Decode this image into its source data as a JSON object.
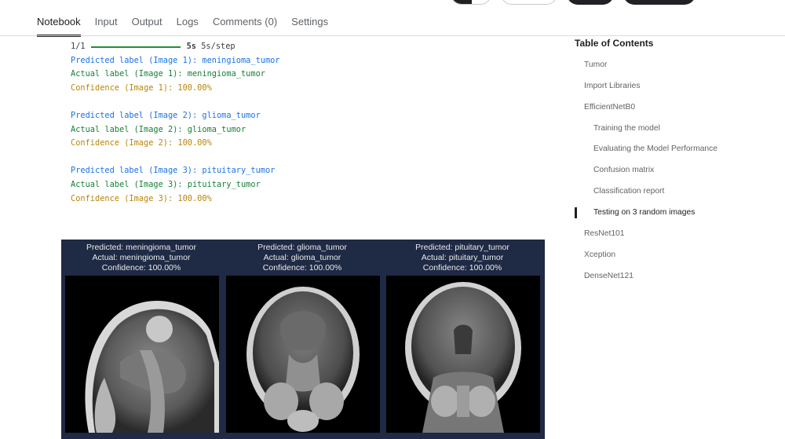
{
  "tabs": [
    {
      "label": "Notebook",
      "active": true
    },
    {
      "label": "Input"
    },
    {
      "label": "Output"
    },
    {
      "label": "Logs"
    },
    {
      "label": "Comments (0)"
    },
    {
      "label": "Settings"
    }
  ],
  "output": {
    "progress": {
      "step": "1/1",
      "time": "5s",
      "rate": "5s/step"
    },
    "results": [
      {
        "predicted": "Predicted label (Image 1): meningioma_tumor",
        "actual": "Actual label (Image 1): meningioma_tumor",
        "confidence": "Confidence (Image 1): 100.00%"
      },
      {
        "predicted": "Predicted label (Image 2): glioma_tumor",
        "actual": "Actual label (Image 2): glioma_tumor",
        "confidence": "Confidence (Image 2): 100.00%"
      },
      {
        "predicted": "Predicted label (Image 3): pituitary_tumor",
        "actual": "Actual label (Image 3): pituitary_tumor",
        "confidence": "Confidence (Image 3): 100.00%"
      }
    ]
  },
  "figure": {
    "panels": [
      {
        "predicted": "Predicted: meningioma_tumor",
        "actual": "Actual: meningioma_tumor",
        "confidence": "Confidence: 100.00%"
      },
      {
        "predicted": "Predicted: glioma_tumor",
        "actual": "Actual: glioma_tumor",
        "confidence": "Confidence: 100.00%"
      },
      {
        "predicted": "Predicted: pituitary_tumor",
        "actual": "Actual: pituitary_tumor",
        "confidence": "Confidence: 100.00%"
      }
    ]
  },
  "toc": {
    "title": "Table of Contents",
    "items": [
      {
        "label": "Tumor"
      },
      {
        "label": "Import Libraries"
      },
      {
        "label": "EfficientNetB0"
      },
      {
        "label": "Training the model"
      },
      {
        "label": "Evaluating the Model Performance"
      },
      {
        "label": "Confusion matrix"
      },
      {
        "label": "Classification report"
      },
      {
        "label": "Testing on 3 random images",
        "active": true
      },
      {
        "label": "ResNet101"
      },
      {
        "label": "Xception"
      },
      {
        "label": "DenseNet121"
      }
    ]
  },
  "colors": {
    "accent": "#202124",
    "predicted": "#1a73e8",
    "actual": "#188038",
    "confidence": "#b8860b",
    "figure_bg": "#1f2a44"
  }
}
